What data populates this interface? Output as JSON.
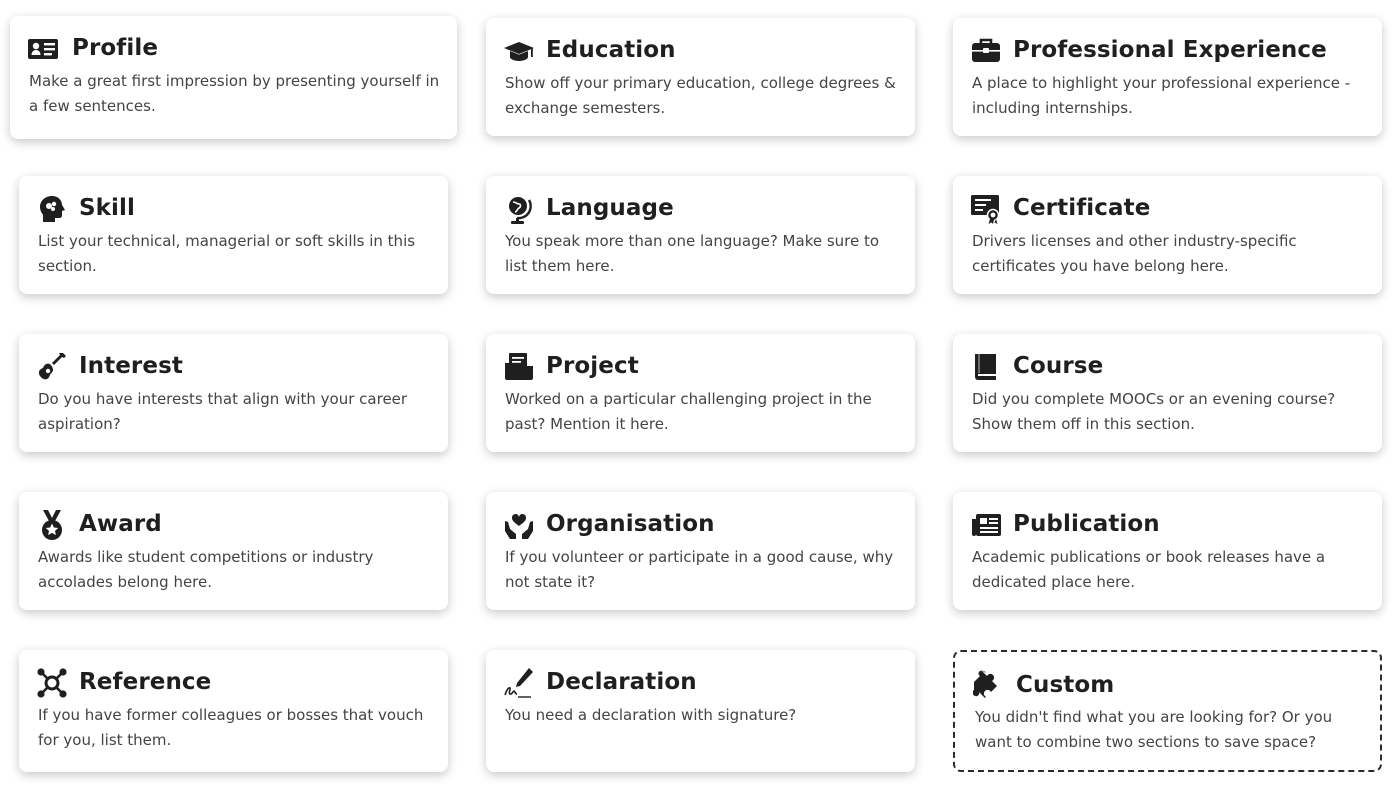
{
  "sections": [
    {
      "key": "profile",
      "title": "Profile",
      "icon": "id-card-icon",
      "description": "Make a great first impression by presenting yourself in a few sentences."
    },
    {
      "key": "education",
      "title": "Education",
      "icon": "graduation-cap-icon",
      "description": "Show off your primary education, college degrees & exchange semesters."
    },
    {
      "key": "experience",
      "title": "Professional Experience",
      "icon": "briefcase-icon",
      "description": "A place to highlight your professional experience - including internships."
    },
    {
      "key": "skill",
      "title": "Skill",
      "icon": "brain-head-icon",
      "description": "List your technical, managerial or soft skills in this section."
    },
    {
      "key": "language",
      "title": "Language",
      "icon": "globe-stand-icon",
      "description": "You speak more than one language? Make sure to list them here."
    },
    {
      "key": "certificate",
      "title": "Certificate",
      "icon": "certificate-icon",
      "description": "Drivers licenses and other industry-specific certificates you have belong here."
    },
    {
      "key": "interest",
      "title": "Interest",
      "icon": "guitar-icon",
      "description": "Do you have interests that align with your career aspiration?"
    },
    {
      "key": "project",
      "title": "Project",
      "icon": "folder-icon",
      "description": "Worked on a particular challenging project in the past? Mention it here."
    },
    {
      "key": "course",
      "title": "Course",
      "icon": "book-icon",
      "description": "Did you complete MOOCs or an evening course? Show them off in this section."
    },
    {
      "key": "award",
      "title": "Award",
      "icon": "medal-icon",
      "description": "Awards like student competitions or industry accolades belong here."
    },
    {
      "key": "organisation",
      "title": "Organisation",
      "icon": "hands-heart-icon",
      "description": "If you volunteer or participate in a good cause, why not state it?"
    },
    {
      "key": "publication",
      "title": "Publication",
      "icon": "newspaper-icon",
      "description": "Academic publications or book releases have a dedicated place here."
    },
    {
      "key": "reference",
      "title": "Reference",
      "icon": "network-icon",
      "description": "If you have former colleagues or bosses that vouch for you, list them."
    },
    {
      "key": "declaration",
      "title": "Declaration",
      "icon": "signature-icon",
      "description": "You need a declaration with signature?"
    },
    {
      "key": "custom",
      "title": "Custom",
      "icon": "puzzle-icon",
      "description": "You didn't find what you are looking for? Or you want to combine two sections to save space?"
    }
  ]
}
